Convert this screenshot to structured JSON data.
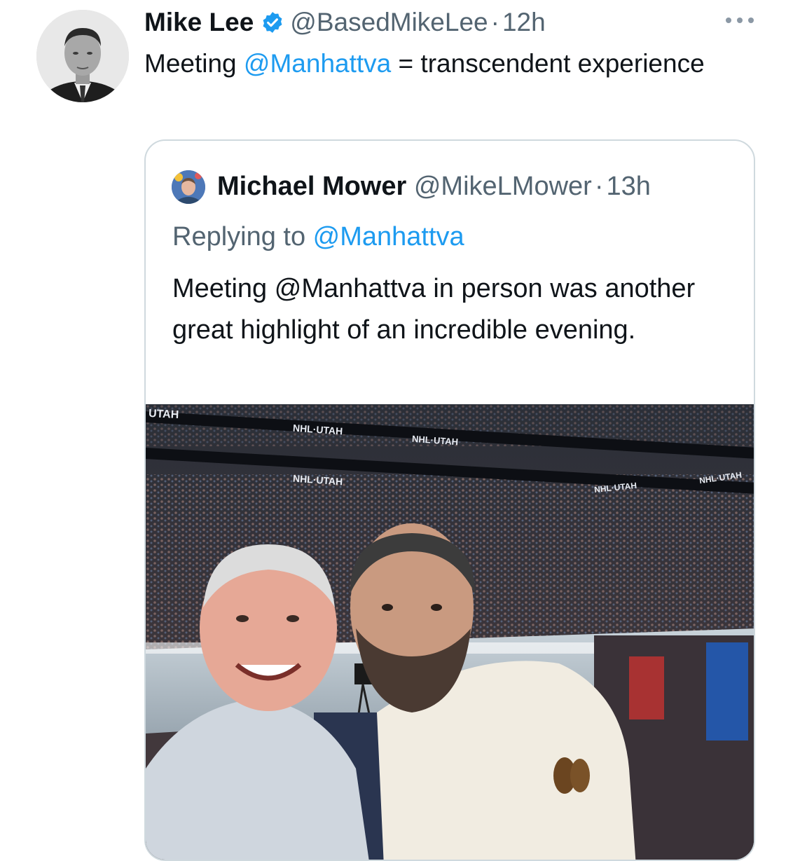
{
  "tweet": {
    "author_name": "Mike Lee",
    "author_handle": "@BasedMikeLee",
    "separator": "·",
    "time": "12h",
    "text_prefix": "Meeting ",
    "text_mention": "@Manhattva",
    "text_suffix": " = transcendent experience"
  },
  "quote": {
    "author_name": "Michael Mower",
    "author_handle": "@MikeLMower",
    "separator": "·",
    "time": "13h",
    "reply_prefix": "Replying to ",
    "reply_mention": "@Manhattva",
    "text": "Meeting @Manhattva in person was another great highlight of an incredible evening."
  },
  "photo": {
    "banner_labels": [
      "UTAH",
      "NHL·UTAH",
      "NHL·UTAH",
      "NHL·UTAH",
      "NHL·UTAH",
      "NHL·UTAH"
    ]
  },
  "colors": {
    "accent": "#1d9bf0",
    "secondary_text": "#536471",
    "border": "#cfd9de"
  },
  "icons": [
    "verified-badge-icon",
    "more-options-icon"
  ]
}
